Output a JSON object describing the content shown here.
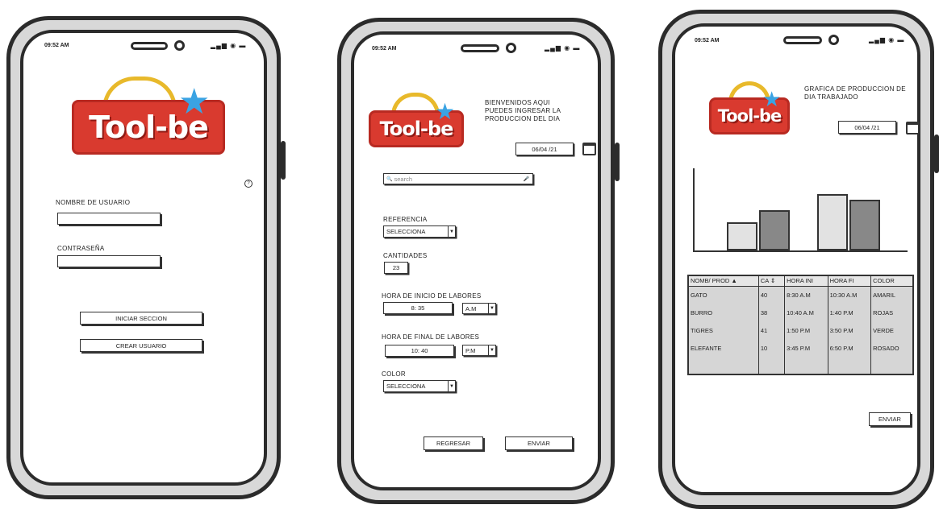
{
  "status_time": "09:52 AM",
  "status_signal": "▂▄▆ ◉ ▬",
  "logo_text": "Tool-be",
  "logo_star": "★",
  "screen1": {
    "help_icon": "?",
    "username_label": "NOMBRE DE USUARIO",
    "username_value": "",
    "password_label": "CONTRASEÑA",
    "password_value": "",
    "login_button": "INICIAR SECCION",
    "create_button": "CREAR USUARIO"
  },
  "screen2": {
    "welcome_text": "BIENVENIDOS AQUI PUEDES INGRESAR LA PRODUCCION DEL DIA",
    "date_value": "06/04 /21",
    "search_placeholder": "search",
    "search_icon": "🔍",
    "mic_icon": "🎤",
    "reference_label": "REFERENCIA",
    "reference_value": "SELECCIONA",
    "quantity_label": "CANTIDADES",
    "quantity_value": "23",
    "start_label": "HORA DE INICIO DE LABORES",
    "start_time": "8: 35",
    "start_ampm": "A.M",
    "end_label": "HORA DE FINAL DE LABORES",
    "end_time": "10: 40",
    "end_ampm": "P.M",
    "color_label": "COLOR",
    "color_value": "SELECCIONA",
    "back_button": "REGRESAR",
    "send_button": "ENVIAR"
  },
  "screen3": {
    "title_text": "GRAFICA DE PRODUCCION DE DIA TRABAJADO",
    "date_value": "06/04 /21",
    "table_headers": [
      "NOMB/ PROD ▲",
      "CA ⇕",
      "HORA INI",
      "HORA FI",
      "COLOR"
    ],
    "table_rows": [
      [
        "GATO",
        "40",
        "8:30 A.M",
        "10:30 A.M",
        "AMARIL"
      ],
      [
        "BURRO",
        "38",
        "10:40 A.M",
        "1:40 P.M",
        "ROJAS"
      ],
      [
        "TIGRES",
        "41",
        "1:50 P.M",
        "3:50 P.M",
        "VERDE"
      ],
      [
        "ELEFANTE",
        "10",
        "3:45 P.M",
        "6:50 P.M",
        "ROSADO"
      ],
      [
        "",
        "",
        "",
        "",
        ""
      ]
    ],
    "send_button": "ENVIAR"
  },
  "chart_data": {
    "type": "bar",
    "categories": [
      "",
      ""
    ],
    "series": [
      {
        "values": [
          35,
          70
        ]
      },
      {
        "values": [
          50,
          63
        ]
      }
    ],
    "ylim": [
      0,
      100
    ],
    "colors": [
      "#e2e2e2",
      "#888888"
    ]
  }
}
